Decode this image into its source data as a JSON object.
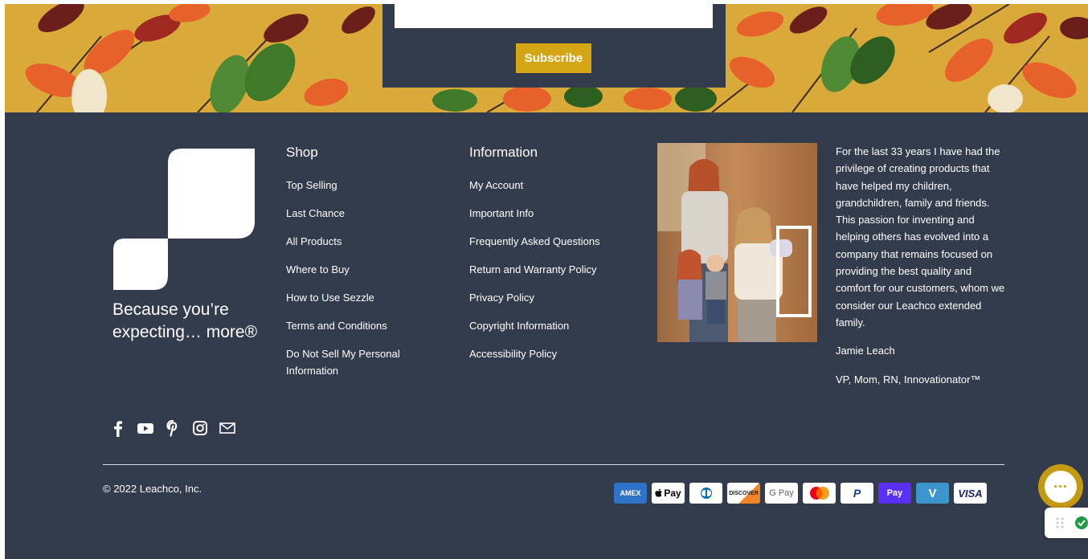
{
  "newsletter": {
    "email_placeholder": "",
    "subscribe_label": "Subscribe"
  },
  "brand": {
    "tagline_line1": "Because you’re",
    "tagline_line2": "expecting… more®"
  },
  "shop": {
    "title": "Shop",
    "links": [
      "Top Selling",
      "Last Chance",
      "All Products",
      "Where to Buy",
      "How to Use Sezzle",
      "Terms and Conditions",
      "Do Not Sell My Personal Information"
    ]
  },
  "information": {
    "title": "Information",
    "links": [
      "My Account",
      "Important Info",
      "Frequently Asked Questions",
      "Return and Warranty Policy",
      "Privacy Policy",
      "Copyright Information",
      "Accessibility Policy"
    ]
  },
  "bio": {
    "text": "For the last 33 years I have had the privilege of creating products that have helped my children, grandchildren, family and friends. This passion for inventing and helping others has evolved into a company that remains focused on providing the best quality and comfort for our customers, whom we consider our Leachco extended family.",
    "name": "Jamie Leach",
    "role": "VP, Mom, RN, Innovationator™"
  },
  "social": [
    "facebook-icon",
    "youtube-icon",
    "pinterest-icon",
    "instagram-icon",
    "email-icon"
  ],
  "copyright": "© 2022 Leachco, Inc.",
  "payments": [
    {
      "name": "amex",
      "label": "AMEX",
      "bg": "#2f73c8",
      "fg": "#ffffff"
    },
    {
      "name": "apple-pay",
      "label": "Pay",
      "bg": "#ffffff",
      "fg": "#000000"
    },
    {
      "name": "diners-club",
      "label": "",
      "bg": "#ffffff",
      "fg": "#0a6fb5"
    },
    {
      "name": "discover",
      "label": "DISCOVER",
      "bg": "#ffffff",
      "fg": "#222222"
    },
    {
      "name": "google-pay",
      "label": "G Pay",
      "bg": "#ffffff",
      "fg": "#5f6368"
    },
    {
      "name": "mastercard",
      "label": "",
      "bg": "#ffffff",
      "fg": "#000000"
    },
    {
      "name": "paypal",
      "label": "P",
      "bg": "#ffffff",
      "fg": "#143c8c"
    },
    {
      "name": "shop-pay",
      "label": "Pay",
      "bg": "#5a31f4",
      "fg": "#ffffff"
    },
    {
      "name": "venmo",
      "label": "V",
      "bg": "#3d95ce",
      "fg": "#ffffff"
    },
    {
      "name": "visa",
      "label": "VISA",
      "bg": "#ffffff",
      "fg": "#1a1f71"
    }
  ],
  "chat": {
    "label": "···"
  }
}
